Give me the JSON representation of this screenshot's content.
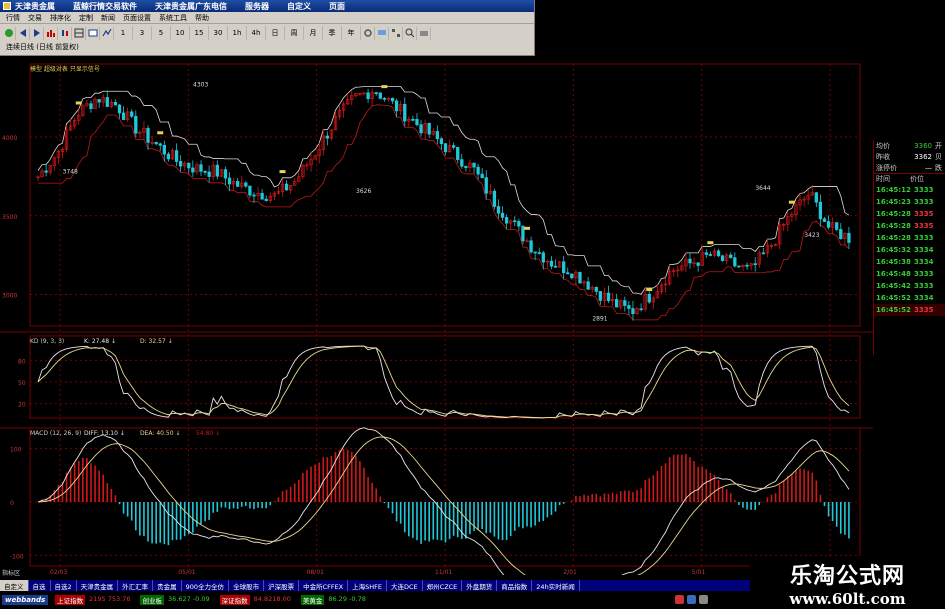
{
  "window": {
    "title_segments": [
      "天津贵金属",
      "蓝鲸行情交易软件",
      "天津贵金属广东电信",
      "服务器",
      "自定义",
      "页面"
    ]
  },
  "menu": [
    "行情",
    "交易",
    "排序化",
    "定制",
    "新闻",
    "页面设置",
    "系统工具",
    "帮助"
  ],
  "toolbar": {
    "icons": [
      "refresh-icon",
      "back-icon",
      "forward-icon",
      "bar-chart-icon",
      "candle-icon",
      "table-icon",
      "window-icon",
      "line-icon"
    ],
    "periods": [
      "1",
      "3",
      "5",
      "10",
      "15",
      "30",
      "1h",
      "4h",
      "日",
      "周",
      "月",
      "季",
      "年"
    ],
    "extra_icons": [
      "gear-icon",
      "screen-icon",
      "tile-icon",
      "zoom-icon",
      "print-icon"
    ]
  },
  "chart": {
    "instrument": "连续日线 (日线 前复权)",
    "indicator_line": "模型  超级对表  只显示信号",
    "kd_header": {
      "name": "KD (9, 3, 3)",
      "k": "K: 27.48 ↓",
      "d": "D: 32.57 ↓"
    },
    "macd_header": {
      "name": "MACD (12, 26, 9)",
      "diff": "DIFF: 13.10 ↓",
      "dea": "DEA: 40.50 ↓",
      "macd": "54.80 ↓"
    },
    "price_ticks": [
      "4000",
      "3500",
      "3000"
    ],
    "kd_ticks": [
      "80",
      "50",
      "20"
    ],
    "macd_ticks": [
      "100",
      "0",
      "-100"
    ],
    "date_labels": [
      "02/03",
      "05/01",
      "08/01",
      "11/01",
      "2/01",
      "5/01",
      "12/01"
    ],
    "price_annotations": [
      "3748",
      "4303",
      "3626",
      "2891",
      "3644",
      "3423"
    ],
    "axis_side_label": "指标区",
    "colors": {
      "up": "#d01818",
      "down": "#20c8d8",
      "grid": "#7a0000",
      "k_line": "#e8e8e8",
      "d_line": "#e8d890"
    }
  },
  "chart_data": {
    "type": "candlestick",
    "x_dates": [
      "02/03",
      "05/01",
      "08/01",
      "11/01",
      "2/01",
      "5/01",
      "12/01"
    ],
    "close_profile": [
      3748,
      3900,
      4150,
      4250,
      4200,
      4050,
      3950,
      3850,
      3800,
      3780,
      3700,
      3650,
      3626,
      3720,
      3900,
      4100,
      4250,
      4303,
      4200,
      4100,
      4000,
      3900,
      3800,
      3600,
      3450,
      3300,
      3200,
      3150,
      3050,
      2950,
      2891,
      3000,
      3150,
      3200,
      3250,
      3200,
      3150,
      3300,
      3500,
      3644,
      3423,
      3360
    ],
    "ylim": [
      2800,
      4400
    ]
  },
  "quote": {
    "rows": [
      {
        "label": "均价",
        "value": "3360",
        "extra": "开"
      },
      {
        "label": "昨收",
        "value": "3362",
        "extra": "贝"
      },
      {
        "label": "涨停价",
        "value": "—",
        "extra": "跌"
      }
    ],
    "tick_header": {
      "time": "时间",
      "price": "价位"
    },
    "ticks": [
      {
        "time": "16:45:12",
        "price": "3333",
        "up": false
      },
      {
        "time": "16:45:23",
        "price": "3333",
        "up": false
      },
      {
        "time": "16:45:28",
        "price": "3335",
        "up": true
      },
      {
        "time": "16:45:28",
        "price": "3335",
        "up": true
      },
      {
        "time": "16:45:28",
        "price": "3333",
        "up": false
      },
      {
        "time": "16:45:32",
        "price": "3334",
        "up": false
      },
      {
        "time": "16:45:38",
        "price": "3334",
        "up": false
      },
      {
        "time": "16:45:48",
        "price": "3333",
        "up": false
      },
      {
        "time": "16:45:42",
        "price": "3333",
        "up": false
      },
      {
        "time": "16:45:52",
        "price": "3334",
        "up": false
      },
      {
        "time": "16:45:52",
        "price": "3335",
        "up": true
      }
    ]
  },
  "bottom_tabs": [
    "自定义",
    "自选",
    "自选2",
    "天津贵金属",
    "外汇汇率",
    "贵金属",
    "900全力全仿",
    "全球股市",
    "沪深股票",
    "中金所CFFEX",
    "上海SHFE",
    "大连DCE",
    "郑州CZCE",
    "外盘期货",
    "商品指数",
    "24h实时新闻"
  ],
  "status": {
    "logo": "webbands",
    "items": [
      {
        "name": "上证指数",
        "value": "2195 753.76",
        "green": false
      },
      {
        "name": "创业板",
        "value": "36.627 -0.09",
        "green": true
      },
      {
        "name": "深证指数",
        "value": "84.8218.00",
        "green": false
      },
      {
        "name": "美黄金",
        "value": "86.29 -0.78",
        "green": true
      }
    ]
  },
  "watermark": {
    "name": "乐淘公式网",
    "url": "www.60lt.com"
  }
}
